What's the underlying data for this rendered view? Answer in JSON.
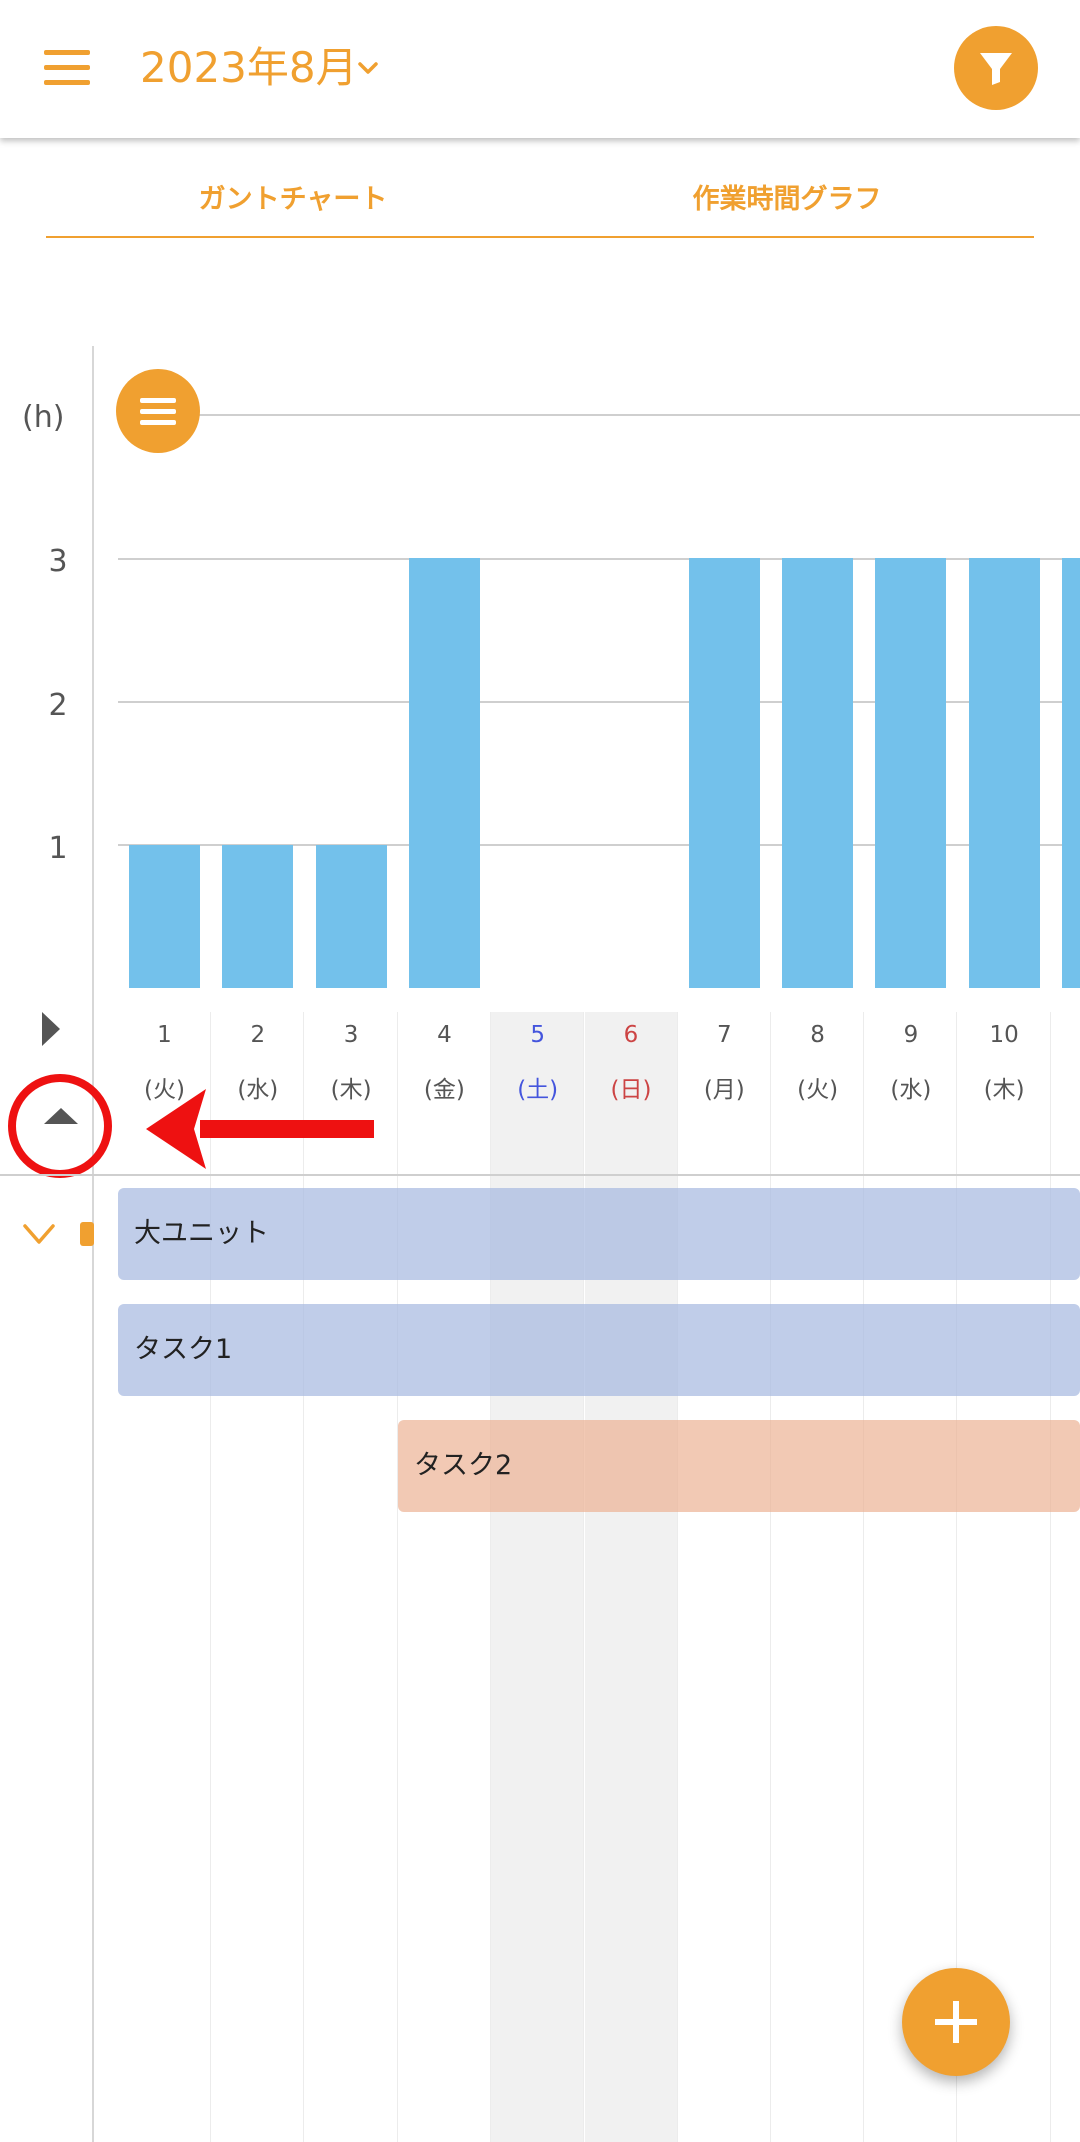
{
  "header": {
    "month_label": "2023年8月",
    "menu_icon": "hamburger-icon",
    "dropdown_icon": "chevron-down-icon",
    "filter_icon": "filter-icon"
  },
  "tabs": [
    {
      "label": "ガントチャート"
    },
    {
      "label": "作業時間グラフ"
    }
  ],
  "chart": {
    "y_unit": "(h)",
    "y_ticks": [
      "3",
      "2",
      "1"
    ]
  },
  "chart_data": {
    "type": "bar",
    "categories": [
      "1",
      "2",
      "3",
      "4",
      "5",
      "6",
      "7",
      "8",
      "9",
      "10"
    ],
    "values": [
      1,
      1,
      1,
      3,
      0,
      0,
      3,
      3,
      3,
      3
    ],
    "ylabel": "(h)",
    "ylim": [
      0,
      4
    ],
    "grid": true
  },
  "days": [
    {
      "num": "1",
      "week": "(火)",
      "type": "weekday"
    },
    {
      "num": "2",
      "week": "(水)",
      "type": "weekday"
    },
    {
      "num": "3",
      "week": "(木)",
      "type": "weekday"
    },
    {
      "num": "4",
      "week": "(金)",
      "type": "weekday"
    },
    {
      "num": "5",
      "week": "(土)",
      "type": "saturday"
    },
    {
      "num": "6",
      "week": "(日)",
      "type": "sunday"
    },
    {
      "num": "7",
      "week": "(月)",
      "type": "weekday"
    },
    {
      "num": "8",
      "week": "(火)",
      "type": "weekday"
    },
    {
      "num": "9",
      "week": "(水)",
      "type": "weekday"
    },
    {
      "num": "10",
      "week": "(木)",
      "type": "weekday"
    }
  ],
  "gantt": {
    "unit_label": "大ユニット",
    "tasks": [
      {
        "label": "タスク1"
      },
      {
        "label": "タスク2"
      }
    ]
  },
  "colors": {
    "accent": "#F0A030",
    "bar": "#73C1EB",
    "saturday": "#4455DD",
    "sunday": "#CC4444",
    "annotation": "#EE1111"
  }
}
